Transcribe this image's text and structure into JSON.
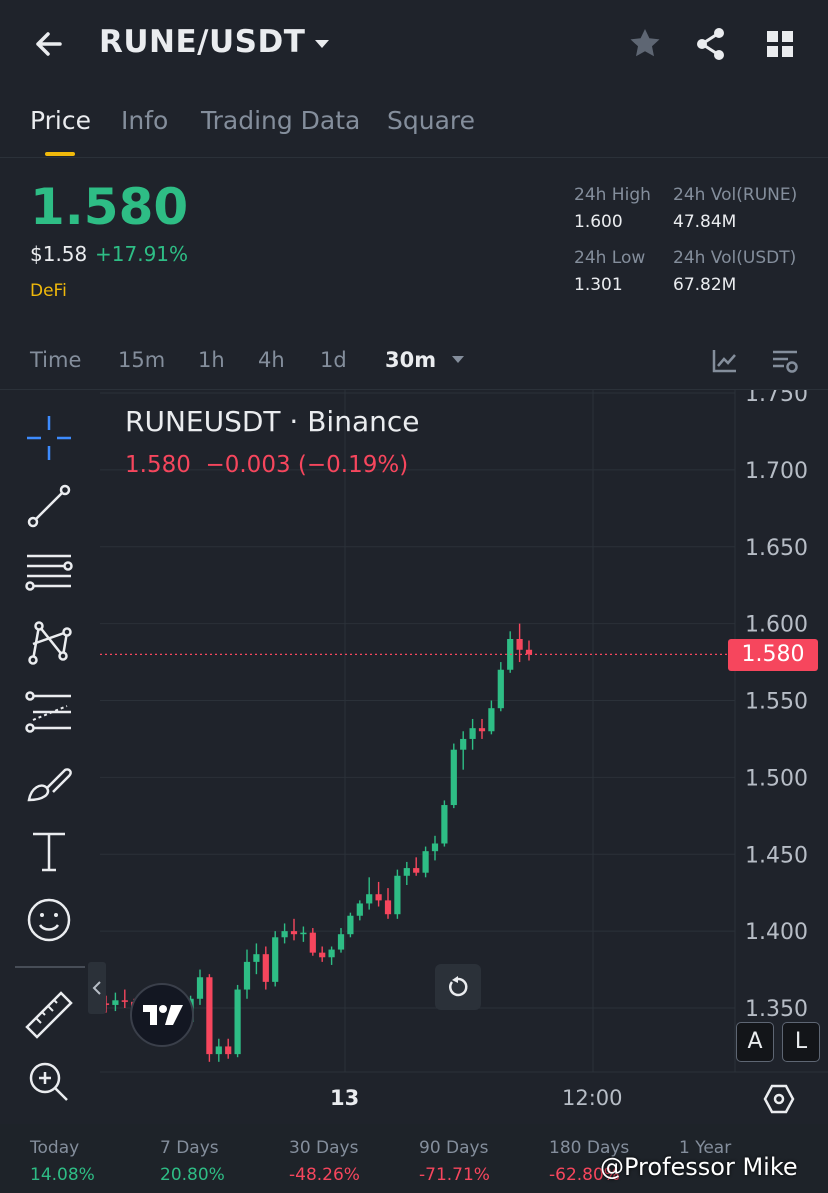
{
  "header": {
    "back_icon": "arrow-left-icon",
    "pair": "RUNE/USDT",
    "caret_icon": "caret-down-icon",
    "icons": [
      "star-icon",
      "share-icon",
      "grid-icon"
    ]
  },
  "tabs": [
    {
      "label": "Price",
      "active": true
    },
    {
      "label": "Info",
      "active": false
    },
    {
      "label": "Trading Data",
      "active": false
    },
    {
      "label": "Square",
      "active": false
    }
  ],
  "ticker": {
    "price": "1.580",
    "usd_price": "$1.58",
    "change_pct": "+17.91%",
    "tag": "DeFi",
    "stats": {
      "high_label": "24h High",
      "high_value": "1.600",
      "low_label": "24h Low",
      "low_value": "1.301",
      "vol_base_label": "24h Vol(RUNE)",
      "vol_base_value": "47.84M",
      "vol_quote_label": "24h Vol(USDT)",
      "vol_quote_value": "67.82M"
    }
  },
  "intervals": {
    "items": [
      "Time",
      "15m",
      "1h",
      "4h",
      "1d",
      "30m"
    ],
    "selected": "30m",
    "right_icons": [
      "chart-indicator-icon",
      "chart-settings-icon"
    ]
  },
  "chart": {
    "symbol_line": "RUNEUSDT · Binance",
    "ohlc_line": "1.580  −0.003 (−0.19%)",
    "current_price_label": "1.580",
    "scale_buttons": [
      "A",
      "L"
    ],
    "x_ticks": [
      "13",
      "12:00"
    ],
    "drawing_tools": [
      "crosshair-icon",
      "trendline-icon",
      "horizontal-lines-icon",
      "pattern-icon",
      "fib-icon",
      "brush-icon",
      "text-icon",
      "emoji-icon",
      "ruler-icon",
      "zoom-in-icon"
    ],
    "colors": {
      "up": "#2ebd85",
      "down": "#f6465d",
      "grid": "#2b3139"
    }
  },
  "chart_data": {
    "type": "candlestick",
    "title": "RUNEUSDT · Binance",
    "interval": "30m",
    "y_ticks": [
      "1.750",
      "1.700",
      "1.650",
      "1.600",
      "1.550",
      "1.500",
      "1.450",
      "1.400",
      "1.350"
    ],
    "ylim": [
      1.31,
      1.755
    ],
    "x_labels": [
      "13",
      "12:00"
    ],
    "last_price": 1.58,
    "candles": [
      {
        "o": 1.353,
        "h": 1.358,
        "l": 1.347,
        "c": 1.352
      },
      {
        "o": 1.352,
        "h": 1.36,
        "l": 1.348,
        "c": 1.355
      },
      {
        "o": 1.355,
        "h": 1.362,
        "l": 1.35,
        "c": 1.354
      },
      {
        "o": 1.354,
        "h": 1.356,
        "l": 1.345,
        "c": 1.347
      },
      {
        "o": 1.347,
        "h": 1.357,
        "l": 1.342,
        "c": 1.352
      },
      {
        "o": 1.352,
        "h": 1.355,
        "l": 1.345,
        "c": 1.348
      },
      {
        "o": 1.348,
        "h": 1.353,
        "l": 1.332,
        "c": 1.334
      },
      {
        "o": 1.334,
        "h": 1.345,
        "l": 1.33,
        "c": 1.343
      },
      {
        "o": 1.343,
        "h": 1.348,
        "l": 1.338,
        "c": 1.341
      },
      {
        "o": 1.341,
        "h": 1.358,
        "l": 1.34,
        "c": 1.356
      },
      {
        "o": 1.356,
        "h": 1.375,
        "l": 1.352,
        "c": 1.37
      },
      {
        "o": 1.37,
        "h": 1.372,
        "l": 1.315,
        "c": 1.32
      },
      {
        "o": 1.32,
        "h": 1.33,
        "l": 1.315,
        "c": 1.325
      },
      {
        "o": 1.325,
        "h": 1.33,
        "l": 1.317,
        "c": 1.32
      },
      {
        "o": 1.32,
        "h": 1.365,
        "l": 1.318,
        "c": 1.362
      },
      {
        "o": 1.362,
        "h": 1.388,
        "l": 1.356,
        "c": 1.38
      },
      {
        "o": 1.38,
        "h": 1.392,
        "l": 1.372,
        "c": 1.385
      },
      {
        "o": 1.385,
        "h": 1.39,
        "l": 1.362,
        "c": 1.367
      },
      {
        "o": 1.367,
        "h": 1.4,
        "l": 1.364,
        "c": 1.396
      },
      {
        "o": 1.396,
        "h": 1.405,
        "l": 1.392,
        "c": 1.4
      },
      {
        "o": 1.4,
        "h": 1.408,
        "l": 1.394,
        "c": 1.398
      },
      {
        "o": 1.398,
        "h": 1.403,
        "l": 1.393,
        "c": 1.399
      },
      {
        "o": 1.399,
        "h": 1.402,
        "l": 1.384,
        "c": 1.386
      },
      {
        "o": 1.386,
        "h": 1.39,
        "l": 1.38,
        "c": 1.383
      },
      {
        "o": 1.383,
        "h": 1.39,
        "l": 1.378,
        "c": 1.388
      },
      {
        "o": 1.388,
        "h": 1.402,
        "l": 1.386,
        "c": 1.398
      },
      {
        "o": 1.398,
        "h": 1.412,
        "l": 1.396,
        "c": 1.41
      },
      {
        "o": 1.41,
        "h": 1.42,
        "l": 1.407,
        "c": 1.418
      },
      {
        "o": 1.418,
        "h": 1.435,
        "l": 1.414,
        "c": 1.424
      },
      {
        "o": 1.424,
        "h": 1.432,
        "l": 1.416,
        "c": 1.42
      },
      {
        "o": 1.42,
        "h": 1.428,
        "l": 1.408,
        "c": 1.411
      },
      {
        "o": 1.411,
        "h": 1.44,
        "l": 1.408,
        "c": 1.436
      },
      {
        "o": 1.436,
        "h": 1.445,
        "l": 1.43,
        "c": 1.441
      },
      {
        "o": 1.441,
        "h": 1.448,
        "l": 1.436,
        "c": 1.438
      },
      {
        "o": 1.438,
        "h": 1.455,
        "l": 1.435,
        "c": 1.452
      },
      {
        "o": 1.452,
        "h": 1.462,
        "l": 1.446,
        "c": 1.457
      },
      {
        "o": 1.457,
        "h": 1.485,
        "l": 1.455,
        "c": 1.482
      },
      {
        "o": 1.482,
        "h": 1.522,
        "l": 1.48,
        "c": 1.518
      },
      {
        "o": 1.518,
        "h": 1.53,
        "l": 1.505,
        "c": 1.525
      },
      {
        "o": 1.525,
        "h": 1.538,
        "l": 1.518,
        "c": 1.532
      },
      {
        "o": 1.532,
        "h": 1.538,
        "l": 1.525,
        "c": 1.53
      },
      {
        "o": 1.53,
        "h": 1.55,
        "l": 1.528,
        "c": 1.545
      },
      {
        "o": 1.545,
        "h": 1.575,
        "l": 1.543,
        "c": 1.57
      },
      {
        "o": 1.57,
        "h": 1.595,
        "l": 1.568,
        "c": 1.59
      },
      {
        "o": 1.59,
        "h": 1.6,
        "l": 1.575,
        "c": 1.583
      },
      {
        "o": 1.583,
        "h": 1.589,
        "l": 1.576,
        "c": 1.58
      }
    ]
  },
  "performance": [
    {
      "label": "Today",
      "value": "14.08%",
      "color": "#2ebd85"
    },
    {
      "label": "7 Days",
      "value": "20.80%",
      "color": "#2ebd85"
    },
    {
      "label": "30 Days",
      "value": "-48.26%",
      "color": "#f6465d"
    },
    {
      "label": "90 Days",
      "value": "-71.71%",
      "color": "#f6465d"
    },
    {
      "label": "180 Days",
      "value": "-62.80%",
      "color": "#f6465d"
    },
    {
      "label": "1 Year",
      "value": "",
      "color": "#f6465d"
    }
  ],
  "watermark": "@Professor Mike"
}
